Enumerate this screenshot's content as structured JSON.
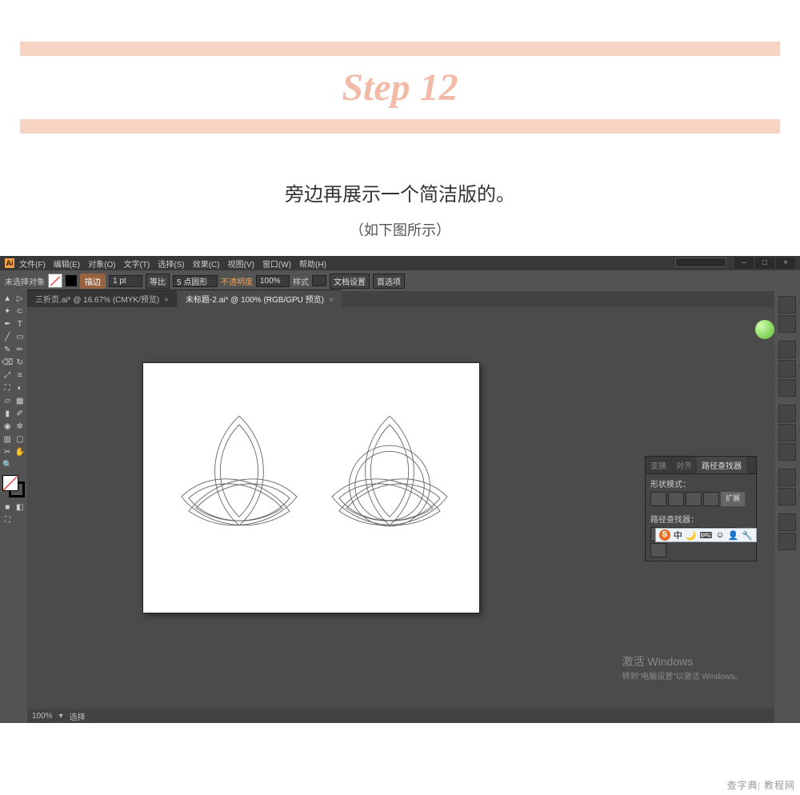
{
  "step": {
    "label": "Step 12"
  },
  "captions": {
    "main": "旁边再展示一个简洁版的。",
    "sub": "（如下图所示）"
  },
  "ai": {
    "logo": "Ai",
    "menu": [
      "文件(F)",
      "编辑(E)",
      "对象(O)",
      "文字(T)",
      "选择(S)",
      "效果(C)",
      "视图(V)",
      "窗口(W)",
      "帮助(H)"
    ],
    "control": {
      "no_selection": "未选择对象",
      "stroke_btn": "描边",
      "stroke_val": "1 pt",
      "uniform": "等比",
      "profile": "5 点圆形",
      "opacity_label": "不透明度",
      "opacity_val": "100%",
      "style": "样式",
      "doc_setup": "文档设置",
      "prefs": "首选项"
    },
    "tabs": {
      "t1": "三折页.ai* @ 16.67% (CMYK/预览)",
      "t2": "未标题-2.ai* @ 100% (RGB/GPU 预览)"
    },
    "status": {
      "zoom": "100%",
      "label": "选择"
    },
    "pathfinder": {
      "tabs": [
        "变换",
        "对齐",
        "路径查找器"
      ],
      "shape_modes": "形状模式：",
      "expand": "扩展",
      "pathfinders": "路径查找器："
    },
    "activate": {
      "title": "激活 Windows",
      "sub": "转到\"电脑设置\"以激活 Windows。"
    },
    "ime": {
      "s": "S",
      "zhong": "中"
    }
  },
  "watermark": "查字典| 教程网"
}
